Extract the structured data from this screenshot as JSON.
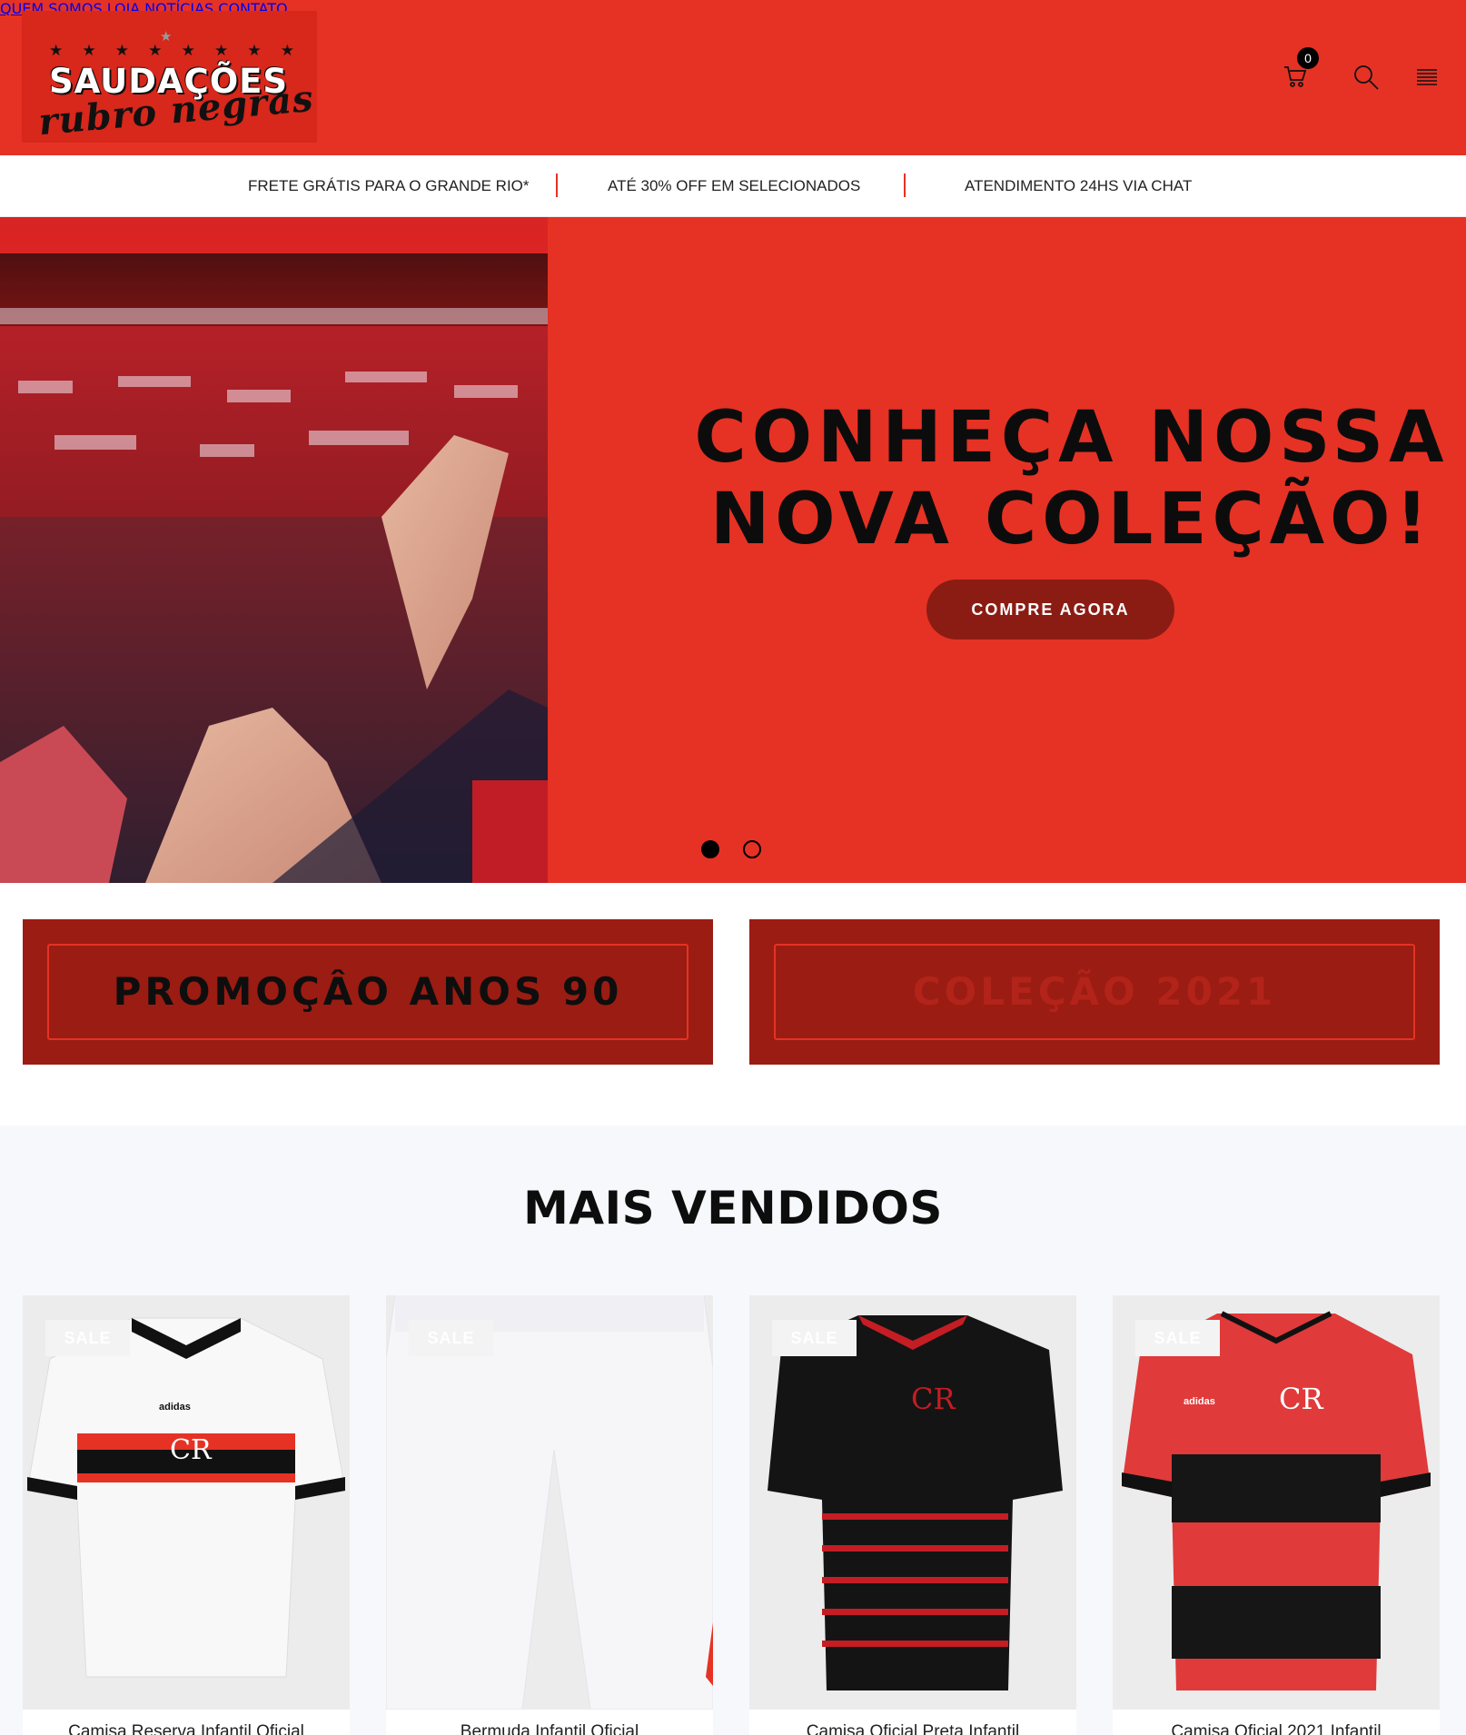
{
  "brand": {
    "logo_main": "SAUDAÇÕES",
    "logo_script": "rubro negras",
    "logo_stars": "★ ★ ★ ★ ★ ★ ★ ★",
    "logo_top_star": "★"
  },
  "nav": {
    "items": [
      {
        "label": "QUEM SOMOS"
      },
      {
        "label": "LOJA"
      },
      {
        "label": "NOTÍCIAS"
      },
      {
        "label": "CONTATO"
      }
    ],
    "cart_count": "0",
    "icons": [
      "cart-icon",
      "search-icon",
      "menu-icon"
    ]
  },
  "infobar": {
    "messages": [
      "FRETE GRÁTIS PARA O GRANDE RIO*",
      "ATÉ 30% OFF EM SELECIONADOS",
      "ATENDIMENTO 24HS VIA CHAT"
    ]
  },
  "hero": {
    "title_line1": "CONHEÇA NOSSA",
    "title_line2": "NOVA COLEÇÃO!",
    "button": "COMPRE AGORA",
    "slides": 2,
    "active_slide": 1
  },
  "promos": [
    {
      "label": "PROMOÇÂO ANOS 90"
    },
    {
      "label": "COLEÇÃO 2021"
    }
  ],
  "best_sellers": {
    "title": "MAIS VENDIDOS",
    "products": [
      {
        "badge": "SALE",
        "name": "Camisa Reserva Infantil Oficial"
      },
      {
        "badge": "SALE",
        "name": "Bermuda Infantil Oficial"
      },
      {
        "badge": "SALE",
        "name": "Camisa Oficial Preta Infantil"
      },
      {
        "badge": "SALE",
        "name": "Camisa Oficial 2021 Infantil"
      }
    ]
  },
  "colors": {
    "brand_red": "#e53224",
    "dark_red": "#9b1c12",
    "button_red": "#8b1c14",
    "black": "#0c0c0c"
  }
}
